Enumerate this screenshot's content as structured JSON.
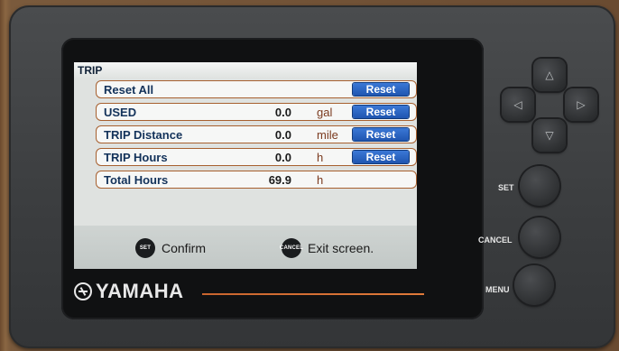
{
  "screen": {
    "title": "TRIP",
    "rows": [
      {
        "label": "Reset All",
        "value": "",
        "unit": "",
        "action": "Reset"
      },
      {
        "label": "USED",
        "value": "0.0",
        "unit": "gal",
        "action": "Reset"
      },
      {
        "label": "TRIP Distance",
        "value": "0.0",
        "unit": "mile",
        "action": "Reset"
      },
      {
        "label": "TRIP Hours",
        "value": "0.0",
        "unit": "h",
        "action": "Reset"
      },
      {
        "label": "Total Hours",
        "value": "69.9",
        "unit": "h",
        "action": ""
      }
    ],
    "footer": {
      "set_key": "SET",
      "set_text": "Confirm",
      "cancel_key": "CANCEL",
      "cancel_text": "Exit screen."
    }
  },
  "device": {
    "brand": "YAMAHA",
    "keys": {
      "set": "SET",
      "cancel": "CANCEL",
      "menu": "MENU"
    },
    "colors": {
      "accent": "#e07a3a",
      "reset_button": "#1f55b0",
      "row_border": "#a7602f"
    },
    "icons": [
      "up-arrow-icon",
      "down-arrow-icon",
      "left-arrow-icon",
      "right-arrow-icon",
      "yamaha-logo-icon"
    ]
  }
}
